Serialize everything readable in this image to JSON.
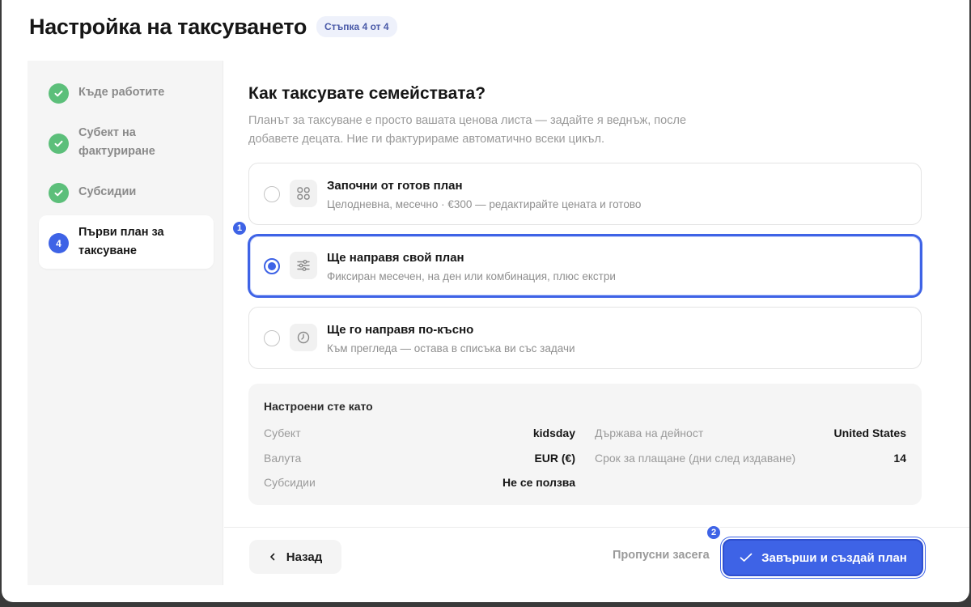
{
  "header": {
    "title": "Настройка на таксуването",
    "step_badge": "Стъпка 4 от 4"
  },
  "sidebar": {
    "items": [
      {
        "label": "Къде работите",
        "status": "done"
      },
      {
        "label": "Субект на фактуриране",
        "status": "done"
      },
      {
        "label": "Субсидии",
        "status": "done"
      },
      {
        "label": "Първи план за таксуване",
        "status": "active",
        "number": "4"
      }
    ]
  },
  "main": {
    "question": "Как таксувате семействата?",
    "subtitle": "Планът за таксуване е просто вашата ценова листа — задайте я веднъж, после добавете децата. Ние ги фактурираме автоматично всеки цикъл.",
    "options": [
      {
        "title": "Започни от готов план",
        "desc": "Целодневна, месечно · €300 — редактирайте цената и готово",
        "icon": "grid-icon",
        "selected": false
      },
      {
        "title": "Ще направя свой план",
        "desc": "Фиксиран месечен, на ден или комбинация, плюс екстри",
        "icon": "sliders-icon",
        "selected": true
      },
      {
        "title": "Ще го направя по-късно",
        "desc": "Към прегледа — остава в списъка ви със задачи",
        "icon": "clock-icon",
        "selected": false
      }
    ],
    "summary": {
      "title": "Настроени сте като",
      "left": [
        {
          "key": "Субект",
          "value": "kidsday"
        },
        {
          "key": "Валута",
          "value": "EUR (€)"
        },
        {
          "key": "Субсидии",
          "value": "Не се ползва"
        }
      ],
      "right": [
        {
          "key": "Държава на дейност",
          "value": "United States"
        },
        {
          "key": "Срок за плащане (дни след издаване)",
          "value": "14"
        }
      ]
    }
  },
  "footer": {
    "back_label": "Назад",
    "skip_label": "Пропусни засега",
    "finish_label": "Завърши и създай план"
  },
  "markers": [
    "1",
    "2"
  ],
  "colors": {
    "accent": "#3e63e6",
    "success": "#5cbf7a"
  }
}
